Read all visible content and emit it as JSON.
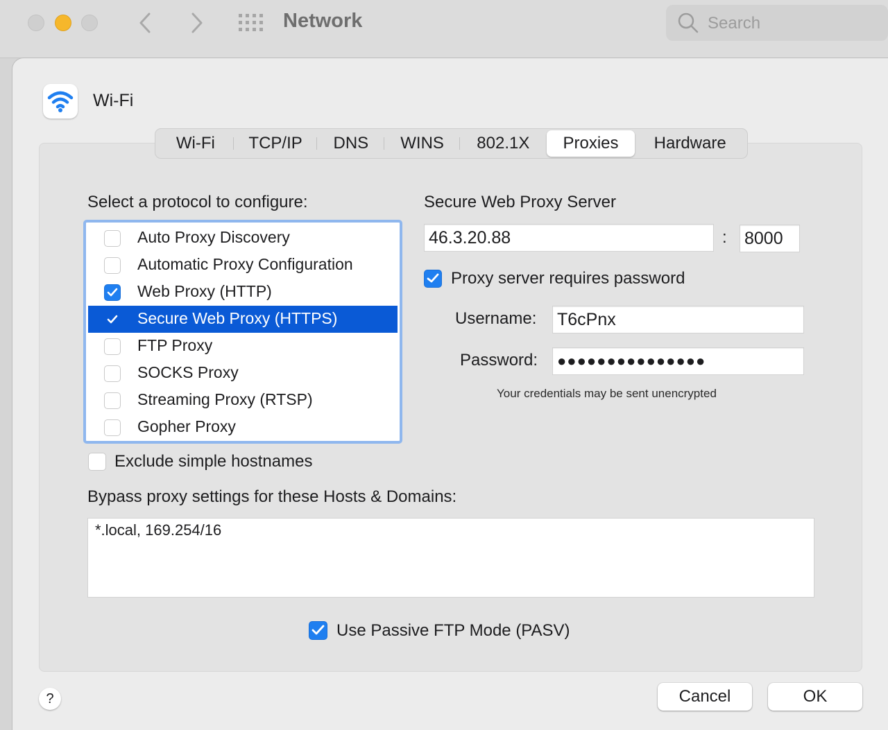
{
  "window": {
    "title": "Network",
    "search_placeholder": "Search"
  },
  "interface": {
    "name": "Wi-Fi"
  },
  "tabs": [
    {
      "label": "Wi-Fi"
    },
    {
      "label": "TCP/IP"
    },
    {
      "label": "DNS"
    },
    {
      "label": "WINS"
    },
    {
      "label": "802.1X"
    },
    {
      "label": "Proxies",
      "active": true
    },
    {
      "label": "Hardware"
    }
  ],
  "protocols": {
    "heading": "Select a protocol to configure:",
    "items": [
      {
        "label": "Auto Proxy Discovery",
        "checked": false
      },
      {
        "label": "Automatic Proxy Configuration",
        "checked": false
      },
      {
        "label": "Web Proxy (HTTP)",
        "checked": true
      },
      {
        "label": "Secure Web Proxy (HTTPS)",
        "checked": true,
        "selected": true
      },
      {
        "label": "FTP Proxy",
        "checked": false
      },
      {
        "label": "SOCKS Proxy",
        "checked": false
      },
      {
        "label": "Streaming Proxy (RTSP)",
        "checked": false
      },
      {
        "label": "Gopher Proxy",
        "checked": false
      }
    ]
  },
  "proxy_server": {
    "heading": "Secure Web Proxy Server",
    "host": "46.3.20.88",
    "separator": ":",
    "port": "8000",
    "requires_password_label": "Proxy server requires password",
    "requires_password": true,
    "username_label": "Username:",
    "username": "T6cPnx",
    "password_label": "Password:",
    "password_masked": "●●●●●●●●●●●●●●●",
    "warning": "Your credentials may be sent unencrypted"
  },
  "exclude_simple_hostnames": {
    "label": "Exclude simple hostnames",
    "checked": false
  },
  "bypass": {
    "label": "Bypass proxy settings for these Hosts & Domains:",
    "value": "*.local, 169.254/16"
  },
  "passive_ftp": {
    "label": "Use Passive FTP Mode (PASV)",
    "checked": true
  },
  "buttons": {
    "help": "?",
    "cancel": "Cancel",
    "ok": "OK"
  },
  "colors": {
    "accent": "#1f7ff0",
    "selection": "#0a5ad6",
    "focus_ring": "#8fb7ee",
    "minimize": "#f6b72b"
  }
}
